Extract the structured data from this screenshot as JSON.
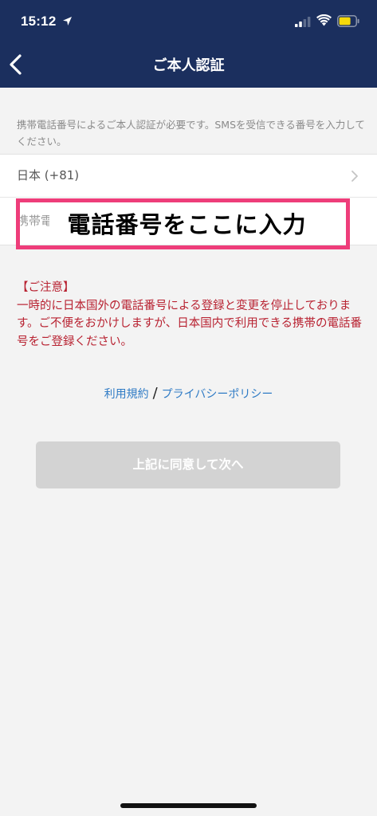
{
  "status_bar": {
    "time": "15:12",
    "location_icon": "location-arrow-icon",
    "signal_icon": "cellular-signal-icon",
    "wifi_icon": "wifi-icon",
    "battery_icon": "battery-icon",
    "battery_color": "#f5d90a"
  },
  "nav": {
    "back_icon": "chevron-left-icon",
    "title": "ご本人認証",
    "background_color": "#1b2f5e"
  },
  "notice": {
    "text": "携帯電話番号によるご本人認証が必要です。SMSを受信できる番号を入力してください。"
  },
  "form": {
    "country_label": "日本 (+81)",
    "country_chevron_icon": "chevron-right-icon",
    "phone_placeholder": "携帯電"
  },
  "annotation": {
    "text": "電話番号をここに入力",
    "border_color": "#ee3d7a"
  },
  "caution": {
    "heading": "【ご注意】",
    "body": "一時的に日本国外の電話番号による登録と変更を停止しております。ご不便をおかけしますが、日本国内で利用できる携帯の電話番号をご登録ください。",
    "color": "#b82231"
  },
  "links": {
    "terms": "利用規約",
    "separator": "/",
    "privacy": "プライバシーポリシー",
    "color": "#2f7bc5"
  },
  "agree_button": {
    "label": "上記に同意して次へ",
    "state": "disabled"
  }
}
